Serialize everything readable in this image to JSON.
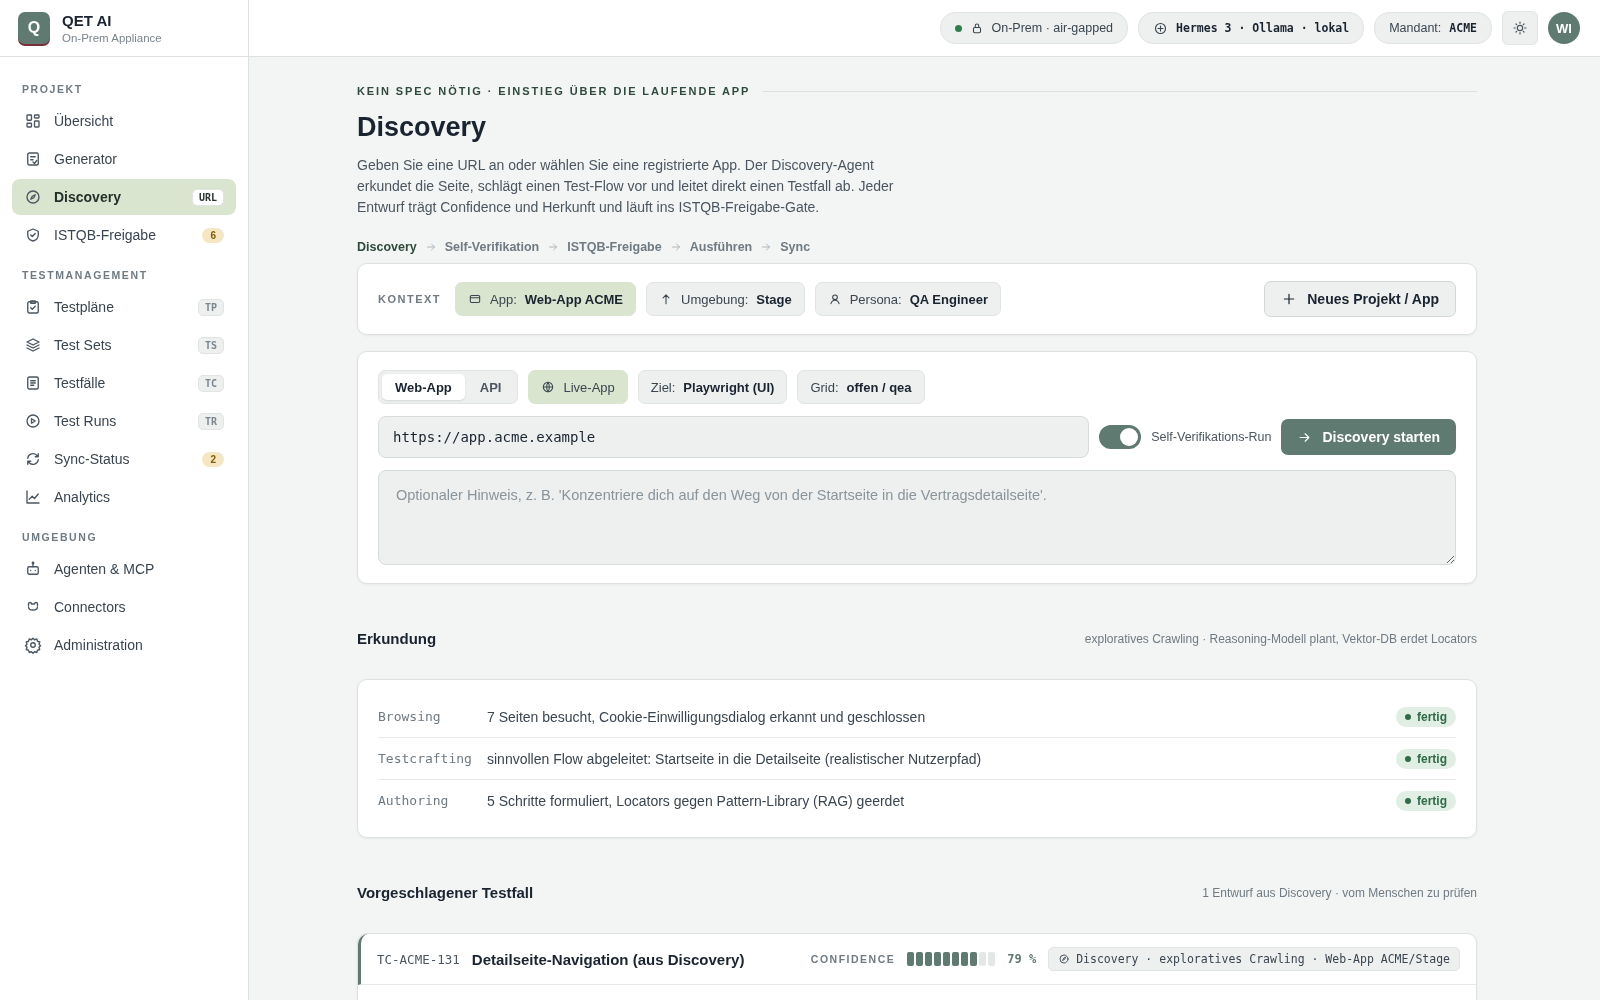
{
  "brand": {
    "logo": "Q",
    "name": "QET AI",
    "subtitle": "On-Prem Appliance"
  },
  "nav": [
    {
      "heading": "PROJEKT",
      "items": [
        {
          "label": "Übersicht",
          "selected": false
        },
        {
          "label": "Generator",
          "selected": false
        },
        {
          "label": "Discovery",
          "badge": {
            "kind": "tag",
            "text": "URL"
          },
          "selected": true
        },
        {
          "label": "ISTQB-Freigabe",
          "badge": {
            "kind": "count",
            "text": "6"
          },
          "selected": false
        }
      ]
    },
    {
      "heading": "TESTMANAGEMENT",
      "items": [
        {
          "label": "Testpläne",
          "badge": {
            "kind": "tag",
            "text": "TP"
          },
          "selected": false
        },
        {
          "label": "Test Sets",
          "badge": {
            "kind": "tag",
            "text": "TS"
          },
          "selected": false
        },
        {
          "label": "Testfälle",
          "badge": {
            "kind": "tag",
            "text": "TC"
          },
          "selected": false
        },
        {
          "label": "Test Runs",
          "badge": {
            "kind": "tag",
            "text": "TR"
          },
          "selected": false
        },
        {
          "label": "Sync-Status",
          "badge": {
            "kind": "count",
            "text": "2"
          },
          "selected": false
        },
        {
          "label": "Analytics",
          "selected": false
        }
      ]
    },
    {
      "heading": "UMGEBUNG",
      "items": [
        {
          "label": "Agenten & MCP",
          "selected": false
        },
        {
          "label": "Connectors",
          "selected": false
        },
        {
          "label": "Administration",
          "selected": false
        }
      ]
    }
  ],
  "topbar": {
    "pills": [
      {
        "kind": "status",
        "text": "On-Prem · air-gapped"
      },
      {
        "kind": "model",
        "text": "Hermes 3 · Ollama · lokal"
      },
      {
        "kind": "tenant",
        "label": "Mandant:",
        "value": "ACME"
      }
    ],
    "avatar": "WI"
  },
  "eyebrow": "KEIN SPEC NÖTIG · EINSTIEG ÜBER DIE LAUFENDE APP",
  "title": "Discovery",
  "intro": "Geben Sie eine URL an oder wählen Sie eine registrierte App. Der Discovery-Agent erkundet die Seite, schlägt einen Test-Flow vor und leitet direkt einen Testfall ab. Jeder Entwurf trägt Confidence und Herkunft und läuft ins ISTQB-Freigabe-Gate.",
  "steps": [
    {
      "label": "Discovery",
      "selected": true
    },
    {
      "label": "Self-Verifikation",
      "selected": false
    },
    {
      "label": "ISTQB-Freigabe",
      "selected": false
    },
    {
      "label": "Ausführen",
      "selected": false
    },
    {
      "label": "Sync",
      "selected": false
    }
  ],
  "context": {
    "label": "KONTEXT",
    "chips": [
      {
        "label": "App:",
        "value": "Web-App ACME",
        "selected": true
      },
      {
        "label": "Umgebung:",
        "value": "Stage",
        "selected": false
      },
      {
        "label": "Persona:",
        "value": "QA Engineer",
        "selected": false
      }
    ],
    "button": "Neues Projekt / App"
  },
  "discovery": {
    "modes": [
      {
        "label": "Web-App",
        "selected": true
      },
      {
        "label": "API",
        "selected": false
      }
    ],
    "chips": [
      {
        "label": "Live-App",
        "selected": true
      },
      {
        "label": "Ziel:",
        "value": "Playwright (UI)",
        "selected": false
      },
      {
        "label": "Grid:",
        "value": "offen / qea",
        "selected": false
      }
    ],
    "url": "https://app.acme.example",
    "toggle": {
      "label": "Self-Verifikations-Run",
      "on": true
    },
    "button": "Discovery starten",
    "hint": {
      "placeholder": "Optionaler Hinweis, z. B. 'Konzentriere dich auf den Weg von der Startseite in die Vertragsdetailseite'."
    }
  },
  "exploration": {
    "title": "Erkundung",
    "note": "exploratives Crawling · Reasoning-Modell plant, Vektor-DB erdet Locators",
    "rows": [
      {
        "phase": "Browsing",
        "text": "7 Seiten besucht, Cookie-Einwilligungsdialog erkannt und geschlossen",
        "status": "fertig",
        "done": true
      },
      {
        "phase": "Testcrafting",
        "text": "sinnvollen Flow abgeleitet: Startseite in die Detailseite (realistischer Nutzerpfad)",
        "status": "fertig",
        "done": true
      },
      {
        "phase": "Authoring",
        "text": "5 Schritte formuliert, Locators gegen Pattern-Library (RAG) geerdet",
        "status": "fertig",
        "done": true
      }
    ]
  },
  "proposal": {
    "title": "Vorgeschlagener Testfall",
    "note": "1 Entwurf aus Discovery · vom Menschen zu prüfen",
    "case": {
      "id": "TC-ACME-131",
      "title": "Detailseite-Navigation (aus Discovery)",
      "confidence_label": "CONFIDENCE",
      "level": 0.79,
      "reading": "79 %",
      "provenance": "Discovery · exploratives Crawling · Web-App ACME/Stage"
    }
  }
}
